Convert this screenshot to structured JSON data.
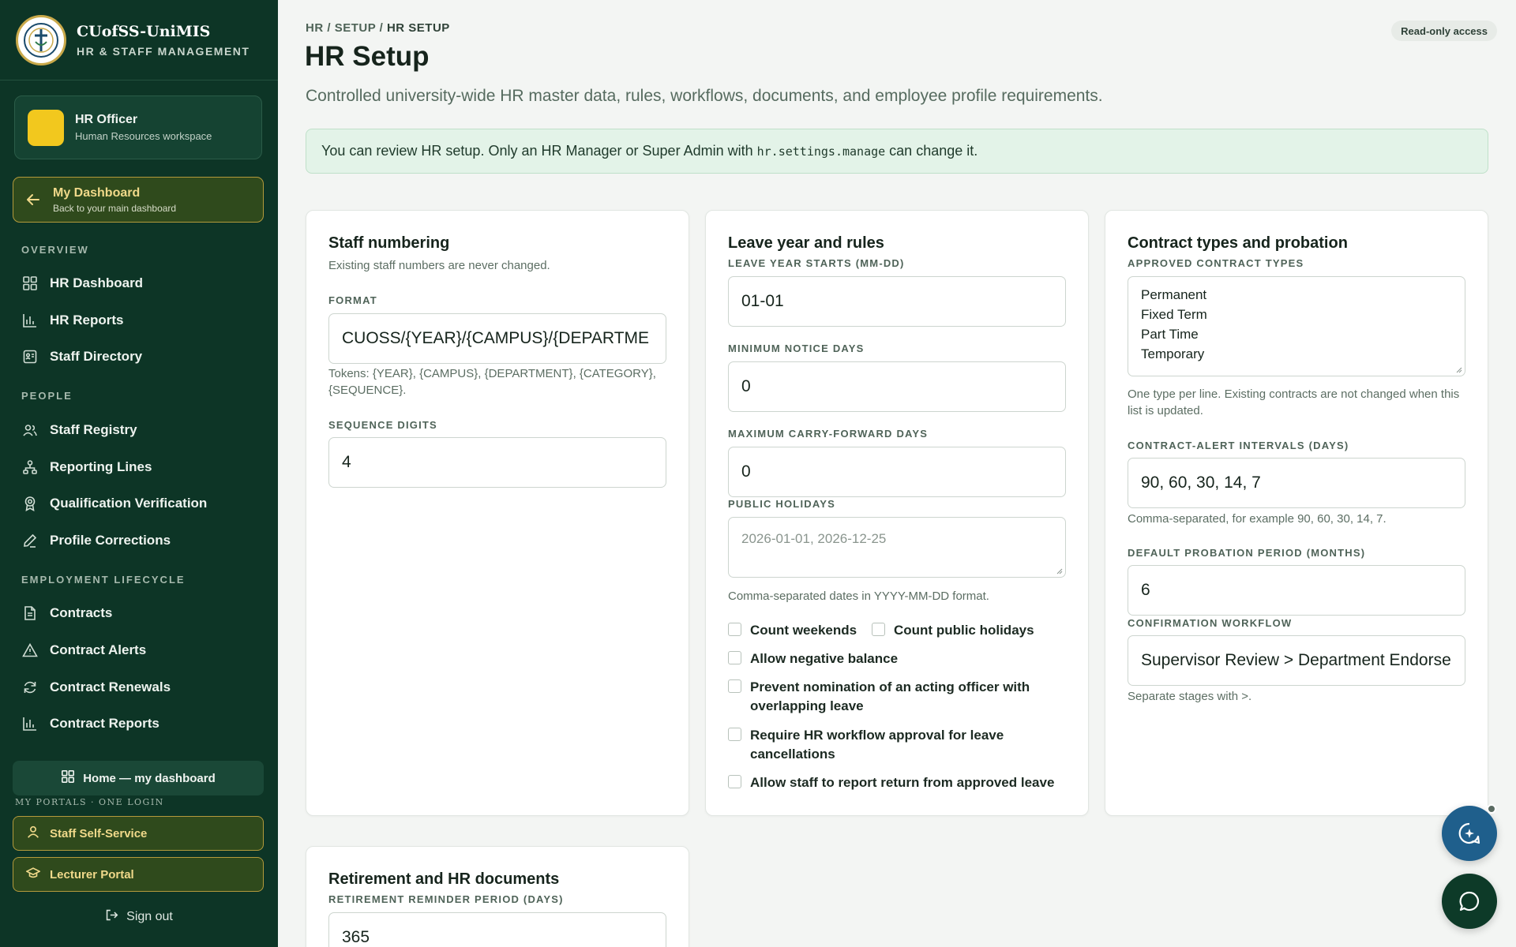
{
  "brand": {
    "name": "CUofSS-UniMIS",
    "subtitle": "HR & STAFF MANAGEMENT"
  },
  "role": {
    "title": "HR Officer",
    "subtitle": "Human Resources workspace"
  },
  "back": {
    "title": "My Dashboard",
    "subtitle": "Back to your main dashboard"
  },
  "nav": {
    "sections": {
      "overview": "OVERVIEW",
      "people": "PEOPLE",
      "lifecycle": "EMPLOYMENT LIFECYCLE"
    },
    "items": {
      "hr_dashboard": "HR Dashboard",
      "hr_reports": "HR Reports",
      "staff_directory": "Staff Directory",
      "staff_registry": "Staff Registry",
      "reporting_lines": "Reporting Lines",
      "qualification_verification": "Qualification Verification",
      "profile_corrections": "Profile Corrections",
      "contracts": "Contracts",
      "contract_alerts": "Contract Alerts",
      "contract_renewals": "Contract Renewals",
      "contract_reports": "Contract Reports"
    }
  },
  "footer": {
    "home": "Home — my dashboard",
    "portals_label": "MY PORTALS · ONE LOGIN",
    "staff_self_service": "Staff Self-Service",
    "lecturer_portal": "Lecturer Portal",
    "sign_out": "Sign out"
  },
  "header": {
    "breadcrumb": {
      "hr": "HR",
      "setup": "SETUP",
      "current": "HR SETUP",
      "sep": "/"
    },
    "badge": "Read-only access",
    "title": "HR Setup",
    "description": "Controlled university-wide HR master data, rules, workflows, documents, and employee profile requirements."
  },
  "notice": {
    "before": "You can review HR setup. Only an HR Manager or Super Admin with",
    "permission": "hr.settings.manage",
    "after": "can change it."
  },
  "staff_numbering": {
    "title": "Staff numbering",
    "subtitle": "Existing staff numbers are never changed.",
    "format_label": "FORMAT",
    "format_value": "CUOSS/{YEAR}/{CAMPUS}/{DEPARTME",
    "tokens_help": "Tokens: {YEAR}, {CAMPUS}, {DEPARTMENT}, {CATEGORY}, {SEQUENCE}.",
    "digits_label": "SEQUENCE DIGITS",
    "digits_value": "4"
  },
  "leave": {
    "title": "Leave year and rules",
    "start_label": "LEAVE YEAR STARTS (MM-DD)",
    "start_value": "01-01",
    "notice_label": "MINIMUM NOTICE DAYS",
    "notice_value": "0",
    "carry_label": "MAXIMUM CARRY-FORWARD DAYS",
    "carry_value": "0",
    "holidays_label": "PUBLIC HOLIDAYS",
    "holidays_placeholder": "2026-01-01, 2026-12-25",
    "holidays_help": "Comma-separated dates in YYYY-MM-DD format.",
    "checks": {
      "count_weekends": "Count weekends",
      "count_public_holidays": "Count public holidays",
      "allow_negative": "Allow negative balance",
      "prevent_nomination": "Prevent nomination of an acting officer with overlapping leave",
      "require_approval": "Require HR workflow approval for leave cancellations",
      "allow_return": "Allow staff to report return from approved leave"
    }
  },
  "contracts": {
    "title": "Contract types and probation",
    "types_label": "APPROVED CONTRACT TYPES",
    "types": [
      "Permanent",
      "Fixed Term",
      "Part Time",
      "Temporary"
    ],
    "types_help": "One type per line. Existing contracts are not changed when this list is updated.",
    "alert_label": "CONTRACT-ALERT INTERVALS (DAYS)",
    "alert_value": "90, 60, 30, 14, 7",
    "alert_help": "Comma-separated, for example 90, 60, 30, 14, 7.",
    "probation_label": "DEFAULT PROBATION PERIOD (MONTHS)",
    "probation_value": "6",
    "workflow_label": "CONFIRMATION WORKFLOW",
    "workflow_value": "Supervisor Review > Department Endorse",
    "workflow_help": "Separate stages with >."
  },
  "retirement": {
    "title": "Retirement and HR documents",
    "reminder_label": "RETIREMENT REMINDER PERIOD (DAYS)",
    "reminder_value": "365"
  },
  "colors": {
    "sidebar": "#0d3526",
    "accent_gold": "#f0d98a",
    "notice_bg": "#e3f3e8",
    "fab_blue": "#1f5f8c",
    "fab_green": "#0d3a28"
  },
  "icons": {
    "fab_top": "ai-chat-icon",
    "fab_bottom": "chat-bubble-icon"
  }
}
